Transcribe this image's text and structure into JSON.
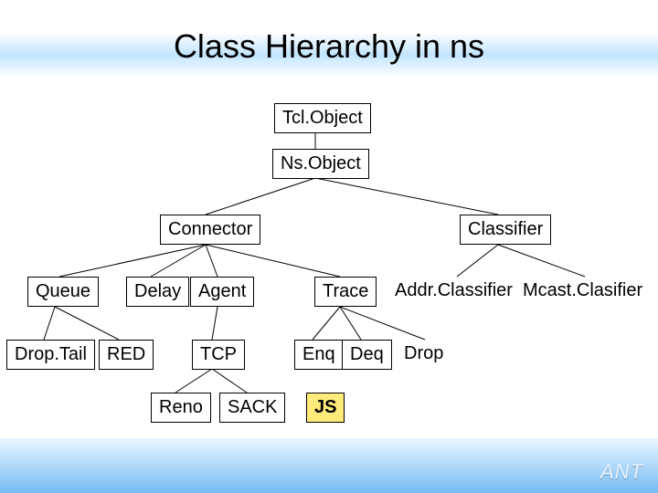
{
  "title": "Class Hierarchy in ns",
  "brand": "ANT",
  "nodes": {
    "tclobject": "Tcl.Object",
    "nsobject": "Ns.Object",
    "connector": "Connector",
    "classifier": "Classifier",
    "queue": "Queue",
    "delay": "Delay",
    "agent": "Agent",
    "trace": "Trace",
    "addrclassifier": "Addr.Classifier",
    "mcastclasifier": "Mcast.Clasifier",
    "droptail": "Drop.Tail",
    "red": "RED",
    "tcp": "TCP",
    "enq": "Enq",
    "deq": "Deq",
    "drop": "Drop",
    "reno": "Reno",
    "sack": "SACK",
    "js": "JS"
  }
}
